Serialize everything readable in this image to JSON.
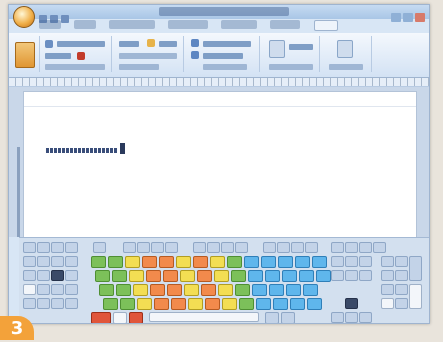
{
  "step_badge": {
    "label": "3"
  },
  "ribbon": {
    "tab_count": 7,
    "active_tab_index": 6
  },
  "colors": {
    "office_button": "#f0b04a",
    "key_green": "#7cc05a",
    "key_yellow": "#f3de53",
    "key_orange": "#f28a4c",
    "key_blue": "#5fb6ec",
    "key_red": "#e0553a",
    "key_base": "#c3d3e8",
    "badge": "#f3a23a"
  },
  "icons": {
    "office_button": "office-orb-icon",
    "paste": "clipboard-icon",
    "cursor": "text-caret-icon"
  }
}
